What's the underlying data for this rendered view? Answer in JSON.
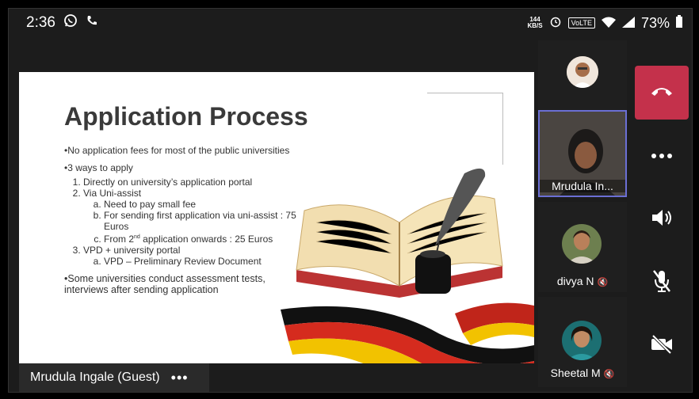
{
  "status_bar": {
    "time": "2:36",
    "speed_top": "144",
    "speed_unit": "KB/S",
    "volte": "VoLTE",
    "battery": "73%"
  },
  "slide": {
    "title": "Application Process",
    "line1": "•No application fees for most of the public universities",
    "line2": "•3 ways to apply",
    "step1": "Directly on university’s application portal",
    "step2": "Via Uni-assist",
    "step2a": "Need to pay small fee",
    "step2b": "For sending first application via uni-assist : 75 Euros",
    "step2c_pre": "From 2",
    "step2c_sup": "nd",
    "step2c_post": " application onwards : 25 Euros",
    "step3": "VPD + university portal",
    "step3a": "VPD – Preliminary Review Document",
    "line3": "•Some universities conduct assessment tests, interviews after sending application"
  },
  "presenter_bar": {
    "name": "Mrudula Ingale (Guest)",
    "more": "•••"
  },
  "participants": [
    {
      "name": ""
    },
    {
      "name": "Mrudula In..."
    },
    {
      "name": "divya N"
    },
    {
      "name": "Sheetal M"
    }
  ],
  "colors": {
    "hangup": "#c4314b",
    "active_border": "#6b6fd4"
  },
  "icons": {
    "hangup": "phone-hangup-icon",
    "more": "more-options-icon",
    "speaker": "speaker-icon",
    "mic": "mic-off-icon",
    "video": "video-off-icon"
  }
}
